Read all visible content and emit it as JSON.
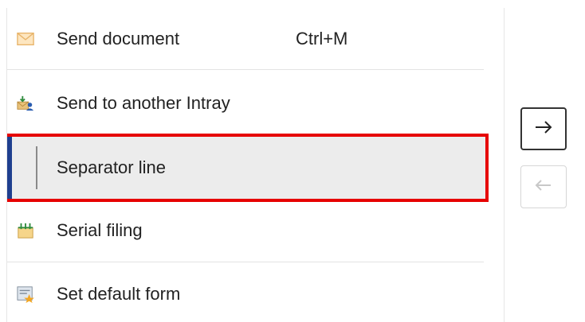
{
  "list": {
    "items": [
      {
        "icon": "envelope-icon",
        "label": "Send document",
        "shortcut": "Ctrl+M"
      },
      {
        "icon": "send-to-intray-icon",
        "label": "Send to another Intray"
      },
      {
        "icon": "separator-line-icon",
        "label": "Separator line",
        "selected": true
      },
      {
        "icon": "serial-filing-icon",
        "label": "Serial filing"
      },
      {
        "icon": "default-form-icon",
        "label": "Set default form"
      }
    ]
  },
  "transfer": {
    "add_icon": "arrow-right-icon",
    "remove_icon": "arrow-left-icon",
    "remove_enabled": false
  },
  "colors": {
    "selection_outline": "#e60000",
    "selection_bar": "#1f3f8f",
    "selection_background": "#ececec"
  }
}
